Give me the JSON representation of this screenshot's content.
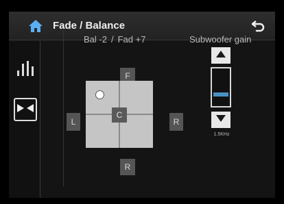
{
  "header": {
    "title": "Fade / Balance"
  },
  "sidebar": {
    "items": [
      {
        "name": "equalizer",
        "icon": "equalizer-bars-icon",
        "active": false
      },
      {
        "name": "fade-balance",
        "icon": "fade-balance-icon",
        "active": true
      }
    ]
  },
  "status": {
    "balance": "Bal -2",
    "separator": "/",
    "fade": "Fad +7"
  },
  "pad": {
    "front_label": "F",
    "left_label": "L",
    "right_label": "R",
    "rear_label": "R",
    "center_label": "C"
  },
  "subwoofer": {
    "label": "Subwoofer gain",
    "value": "1.5KHz",
    "level_fraction": 0.4
  },
  "colors": {
    "accent": "#4a90c2",
    "pad": "#c5c5c5",
    "button": "#555555"
  }
}
